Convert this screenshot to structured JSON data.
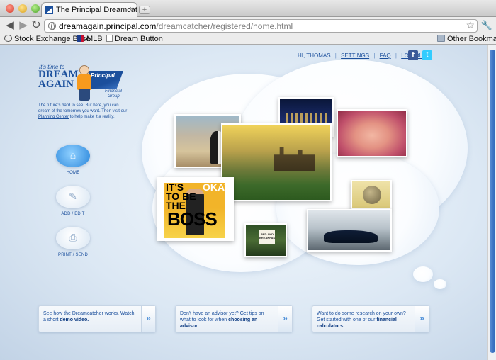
{
  "browser": {
    "tab_title": "The Principal Dreamcatcher",
    "new_tab": "+",
    "url_host": "dreamagain.principal.com",
    "url_path": "/dreamcatcher/registered/home.html",
    "bookmarks": [
      "Stock Exchange Base",
      "MLB",
      "Dream Button"
    ],
    "other_bookmarks": "Other Bookmarks"
  },
  "topnav": {
    "greeting": "HI, THOMAS",
    "settings": "SETTINGS",
    "faq": "FAQ",
    "logout": "LOG OUT",
    "separator": "|",
    "facebook": "f",
    "twitter": "t"
  },
  "logo": {
    "tagline": "It's time to",
    "line1": "DREAM",
    "line2": "AGAIN",
    "brand": "Principal",
    "brand_sub1": "Financial",
    "brand_sub2": "Group"
  },
  "intro": {
    "text_before": "The future's hard to see. But here, you can dream of the tomorrow you want. Then visit our ",
    "link": "Planning Center",
    "text_after": " to help make it a reality."
  },
  "sidenav": {
    "home": "HOME",
    "add_edit": "ADD / EDIT",
    "print_send": "PRINT / SEND"
  },
  "collage": {
    "book_line1": "IT'S",
    "book_line2": "OKAY",
    "book_line3": "TO BE",
    "book_line4": "THE",
    "book_big": "BOSS",
    "sign": "BED AND BREAKFAST"
  },
  "cards": [
    {
      "text": "See how the Dreamcatcher works. Watch a short ",
      "bold": "demo video.",
      "arrow": "»"
    },
    {
      "text": "Don't have an advisor yet? Get tips on what to look for when ",
      "bold": "choosing an advisor.",
      "arrow": "»"
    },
    {
      "text": "Want to do some research on your own? Get started with one of our ",
      "bold": "financial calculators.",
      "arrow": "»"
    }
  ],
  "colors": {
    "accent": "#1b4f9c",
    "arrow": "#4f90d8"
  }
}
